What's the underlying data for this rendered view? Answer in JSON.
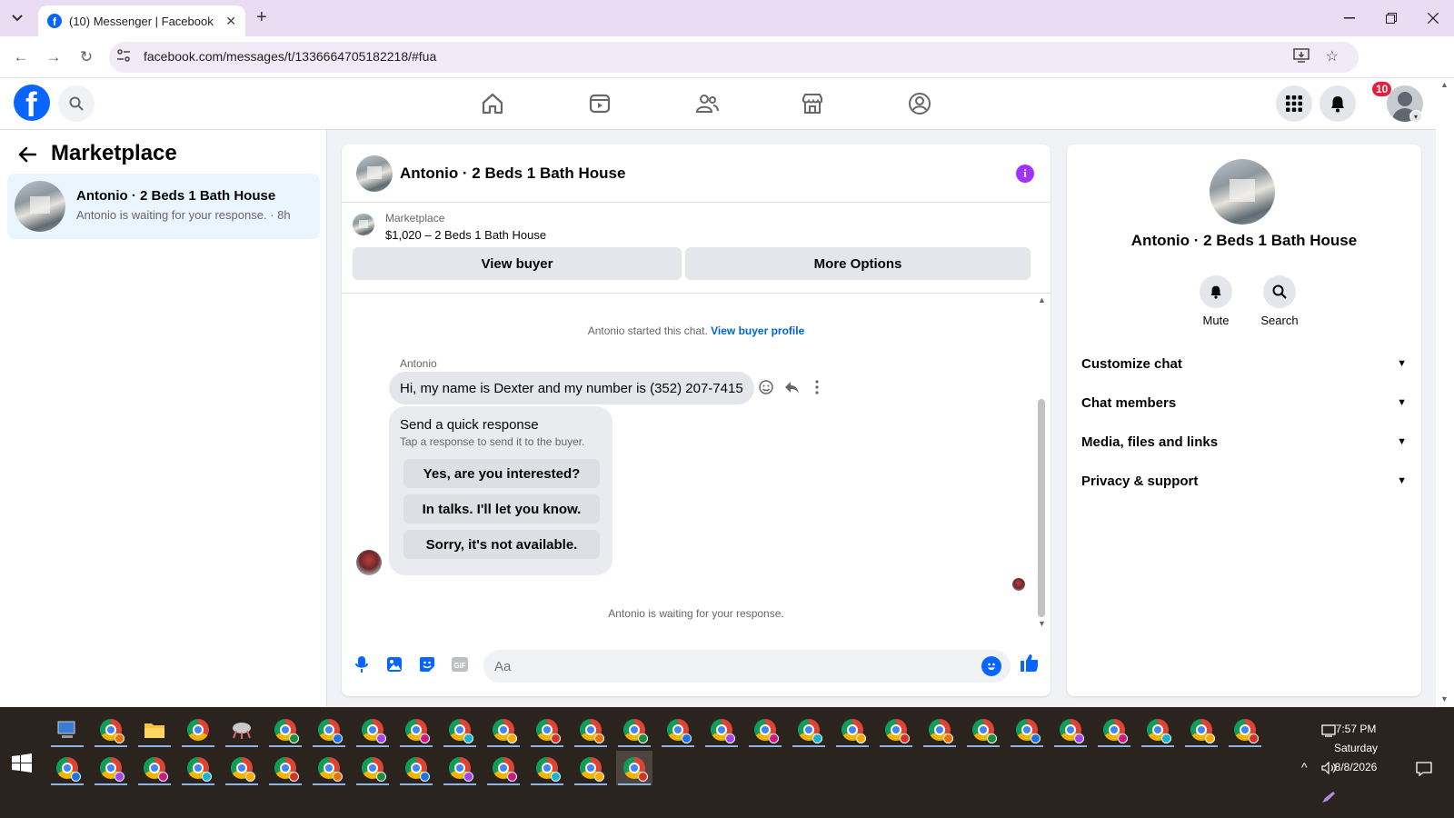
{
  "browser": {
    "tab_title": "(10) Messenger | Facebook",
    "url": "facebook.com/messages/t/1336664705182218/#fua",
    "new_tab_symbol": "+",
    "close_tab_symbol": "✕"
  },
  "fb_header": {
    "logo_letter": "f",
    "notification_count": "10",
    "nav_icons": [
      "home-icon",
      "video-icon",
      "friends-icon",
      "marketplace-icon",
      "gaming-icon"
    ]
  },
  "sidebar": {
    "title": "Marketplace",
    "conversations": [
      {
        "name": "Antonio · 2 Beds 1 Bath House",
        "preview": "Antonio is waiting for your response. · 8h"
      }
    ]
  },
  "chat": {
    "title": "Antonio · 2 Beds 1 Bath House",
    "listing": {
      "label": "Marketplace",
      "price_title": "$1,020 – 2 Beds 1 Bath House",
      "view_buyer": "View buyer",
      "more_options": "More Options"
    },
    "started_text": "Antonio started this chat.",
    "view_profile_link": "View buyer profile",
    "sender_name": "Antonio",
    "message": "Hi, my name is Dexter and my number is (352) 207-7415",
    "quick_response": {
      "title": "Send a quick response",
      "subtitle": "Tap a response to send it to the buyer.",
      "options": [
        "Yes, are you interested?",
        "In talks. I'll let you know.",
        "Sorry, it's not available."
      ]
    },
    "waiting_text": "Antonio is waiting for your response.",
    "composer_placeholder": "Aa"
  },
  "details_panel": {
    "name": "Antonio · 2 Beds 1 Bath House",
    "actions": [
      {
        "label": "Mute",
        "icon": "bell-icon"
      },
      {
        "label": "Search",
        "icon": "search-icon"
      }
    ],
    "sections": [
      "Customize chat",
      "Chat members",
      "Media, files and links",
      "Privacy & support"
    ]
  },
  "taskbar": {
    "time": "7:57 PM",
    "day": "Saturday",
    "date": "8/8/2026"
  },
  "colors": {
    "fb_blue": "#0866ff",
    "link_blue": "#0064d1",
    "badge_red": "#e41e3f",
    "info_purple": "#a033ff",
    "tabstrip": "#eadcf2",
    "taskbar": "#2b231d"
  }
}
